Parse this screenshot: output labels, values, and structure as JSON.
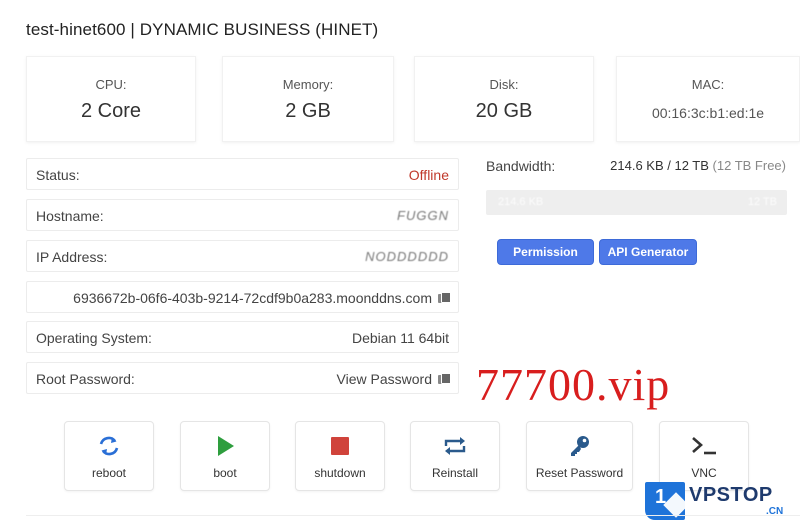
{
  "header": {
    "title": "test-hinet600 | DYNAMIC BUSINESS (HINET)"
  },
  "stats": {
    "cpu": {
      "label": "CPU:",
      "value": "2 Core"
    },
    "memory": {
      "label": "Memory:",
      "value": "2 GB"
    },
    "disk": {
      "label": "Disk:",
      "value": "20 GB"
    },
    "mac": {
      "label": "MAC:",
      "value": "00:16:3c:b1:ed:1e"
    }
  },
  "info": {
    "status": {
      "label": "Status:",
      "value": "Offline"
    },
    "hostname": {
      "label": "Hostname:",
      "value": "FUGGN"
    },
    "ip": {
      "label": "IP Address:",
      "value": "NODDDDDD"
    },
    "domain": {
      "value": "6936672b-06f6-403b-9214-72cdf9b0a283.moonddns.com"
    },
    "os": {
      "label": "Operating System:",
      "value": "Debian 11 64bit"
    },
    "root_password": {
      "label": "Root Password:",
      "value": "View Password"
    }
  },
  "bandwidth": {
    "label": "Bandwidth:",
    "used": "214.6 KB / 12 TB",
    "free": "(12 TB Free)",
    "bar_left": "214.6 KB",
    "bar_right": "12 TB"
  },
  "buttons": {
    "first": "Permission",
    "api_generator": "API Generator"
  },
  "watermark": "77700.vip",
  "actions": [
    {
      "label": "reboot",
      "icon": "reboot-icon",
      "color": "#2a6fd6"
    },
    {
      "label": "boot",
      "icon": "play-icon",
      "color": "#2e9e3e"
    },
    {
      "label": "shutdown",
      "icon": "stop-icon",
      "color": "#d0433b"
    },
    {
      "label": "Reinstall",
      "icon": "reinstall-icon",
      "color": "#2a5a8c"
    },
    {
      "label": "Reset Password",
      "icon": "key-icon",
      "color": "#2a5a8c"
    },
    {
      "label": "VNC",
      "icon": "terminal-icon",
      "color": "#333333"
    }
  ],
  "logo": {
    "one": "1",
    "text": "VPSTOP",
    "cn": ".CN"
  }
}
